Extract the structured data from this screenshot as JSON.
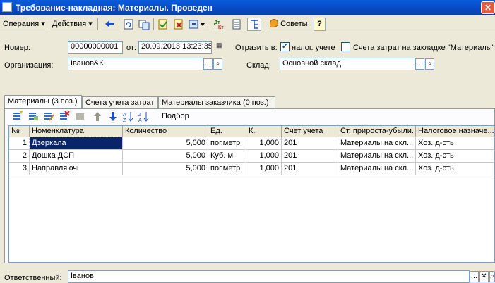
{
  "window": {
    "title": "Требование-накладная: Материалы. Проведен",
    "close_glyph": "✕"
  },
  "toolbar": {
    "operation_label": "Операция",
    "actions_label": "Действия",
    "tips_label": "Советы",
    "help_label": "?",
    "dt_kt_label": "Дт Кт"
  },
  "header": {
    "number_label": "Номер:",
    "number_value": "00000000001",
    "date_label": "от:",
    "date_value": "20.09.2013 13:23:35",
    "reflect_label": "Отразить в:",
    "tax_accounting_label": "налог. учете",
    "tax_accounting_checked": true,
    "cost_accounts_label": "Счета затрат на закладке \"Материалы\"",
    "cost_accounts_checked": false,
    "organization_label": "Организация:",
    "organization_value": "Іванов&К",
    "warehouse_label": "Склад:",
    "warehouse_value": "Основной склад"
  },
  "tabs": [
    {
      "label": "Материалы (3 поз.)"
    },
    {
      "label": "Счета учета затрат"
    },
    {
      "label": "Материалы заказчика (0 поз.)"
    }
  ],
  "panel_toolbar": {
    "selection_label": "Подбор"
  },
  "table": {
    "columns": [
      "№",
      "Номенклатура",
      "Количество",
      "Ед.",
      "К.",
      "Счет учета",
      "Ст. прироста-убыли...",
      "Налоговое назначе..."
    ],
    "rows": [
      {
        "n": "1",
        "name": "Дзеркала",
        "qty": "5,000",
        "unit": "пог.метр",
        "k": "1,000",
        "account": "201",
        "article": "Материалы на скл...",
        "tax": "Хоз. д-сть"
      },
      {
        "n": "2",
        "name": "Дошка ДСП",
        "qty": "5,000",
        "unit": "Куб. м",
        "k": "1,000",
        "account": "201",
        "article": "Материалы на скл...",
        "tax": "Хоз. д-сть"
      },
      {
        "n": "3",
        "name": "Направляючі",
        "qty": "5,000",
        "unit": "пог.метр",
        "k": "1,000",
        "account": "201",
        "article": "Материалы на скл...",
        "tax": "Хоз. д-сть"
      }
    ]
  },
  "footer": {
    "responsible_label": "Ответственный:",
    "responsible_value": "Іванов"
  },
  "colors": {
    "titlebar": "#0A5CDB",
    "selection": "#0A246A",
    "window_bg": "#ECE9D8"
  }
}
